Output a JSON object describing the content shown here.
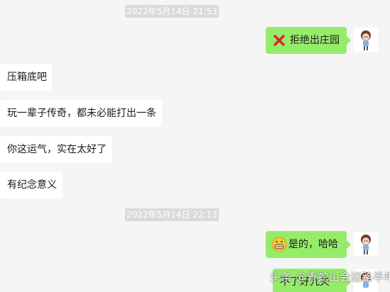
{
  "timestamps": [
    "2022年5月14日 21:53",
    "2022年5月14日 22:13"
  ],
  "messages": {
    "m1": "拒绝出庄园",
    "m2": "压箱底吧",
    "m3": "玩一辈子传奇，都未必能打出一条",
    "m4": "你这运气，实在太好了",
    "m5": "有纪念意义",
    "m6": "是的，哈哈",
    "m7": "不了好九夫"
  },
  "icons": {
    "m1": "cross-mark-icon",
    "m6": "grinning-face-icon"
  },
  "watermark": "头条 @青蛇山会迷路半年",
  "colors": {
    "background": "#f5f5f5",
    "outgoing_bubble": "#95ec69",
    "incoming_bubble": "#ffffff",
    "timestamp_bg": "#dadada"
  }
}
